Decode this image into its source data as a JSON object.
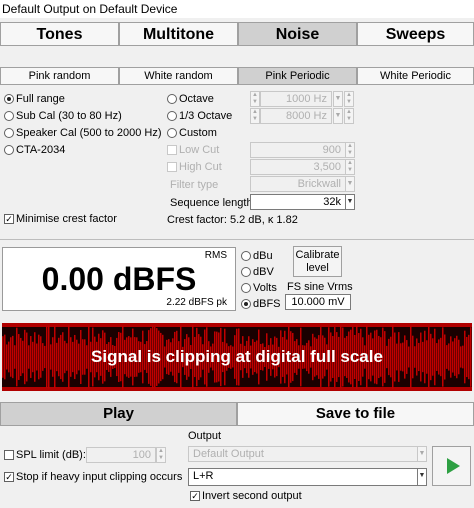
{
  "window": {
    "title": "Default Output on Default Device"
  },
  "main_tabs": [
    {
      "label": "Tones",
      "selected": false
    },
    {
      "label": "Multitone",
      "selected": false
    },
    {
      "label": "Noise",
      "selected": true
    },
    {
      "label": "Sweeps",
      "selected": false
    }
  ],
  "sub_tabs": [
    {
      "label": "Pink random",
      "selected": false
    },
    {
      "label": "White random",
      "selected": false
    },
    {
      "label": "Pink Periodic",
      "selected": true
    },
    {
      "label": "White Periodic",
      "selected": false
    }
  ],
  "range_options": [
    {
      "label": "Full range",
      "selected": true
    },
    {
      "label": "Sub Cal (30 to 80 Hz)",
      "selected": false
    },
    {
      "label": "Speaker Cal (500 to 2000 Hz)",
      "selected": false
    },
    {
      "label": "CTA-2034",
      "selected": false
    }
  ],
  "band_options": [
    {
      "label": "Octave",
      "value": "1000 Hz",
      "selected": false
    },
    {
      "label": "1/3 Octave",
      "value": "8000 Hz",
      "selected": false
    },
    {
      "label": "Custom",
      "selected": false
    }
  ],
  "custom": {
    "low_cut_label": "Low Cut",
    "low_cut_value": "900",
    "high_cut_label": "High Cut",
    "high_cut_value": "3,500",
    "filter_type_label": "Filter type",
    "filter_type_value": "Brickwall"
  },
  "sequence": {
    "label": "Sequence length:",
    "value": "32k"
  },
  "crest": {
    "minimise_label": "Minimise crest factor",
    "minimise_checked": true,
    "factor_text": "Crest factor: 5.2 dB, κ 1.82"
  },
  "meter": {
    "mode": "RMS",
    "value": "0.00 dBFS",
    "peak": "2.22 dBFS pk"
  },
  "units": [
    {
      "label": "dBu",
      "selected": false
    },
    {
      "label": "dBV",
      "selected": false
    },
    {
      "label": "Volts",
      "selected": false
    },
    {
      "label": "dBFS",
      "selected": true
    }
  ],
  "calibrate": {
    "label": "Calibrate level",
    "fs_label": "FS sine Vrms",
    "fs_value": "10.000 mV"
  },
  "banner": {
    "message": "Signal is clipping at digital full scale",
    "color": "#c00000"
  },
  "actions": {
    "play": "Play",
    "save": "Save to file"
  },
  "spl": {
    "label": "SPL limit (dB):",
    "value": "100",
    "checked": false
  },
  "stop_clipping": {
    "label": "Stop if heavy input clipping occurs",
    "checked": true
  },
  "output": {
    "label": "Output",
    "device": "Default Output",
    "channels": "L+R",
    "invert_label": "Invert second output",
    "invert_checked": true
  },
  "play_icon": "play-icon",
  "colors": {
    "play_green": "#2ea043",
    "banner_red": "#c00000"
  }
}
